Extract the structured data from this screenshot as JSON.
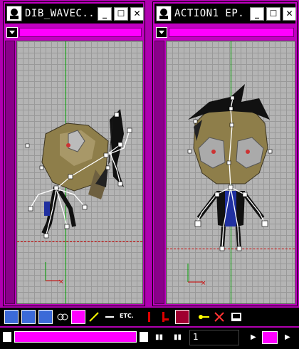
{
  "windows": [
    {
      "title": "DIB_WAVEC..."
    },
    {
      "title": "ACTION1 EP..."
    }
  ],
  "title_buttons": {
    "minimize": "_",
    "maximize": "☐",
    "close": "✕"
  },
  "toolbar": {
    "etc_label": "ETC."
  },
  "statusbar": {
    "frame_value": "1"
  },
  "colors": {
    "chrome": "#c000c0",
    "accent": "#ff00ff",
    "grid": "#b4b4b4",
    "axis_green": "#00a000",
    "axis_red": "#cc0000"
  },
  "icons": [
    "app-icon",
    "dropdown-icon",
    "move-icon",
    "rotate-icon",
    "link-icon",
    "bone-icon",
    "key-icon",
    "render-icon",
    "loop-icon"
  ]
}
